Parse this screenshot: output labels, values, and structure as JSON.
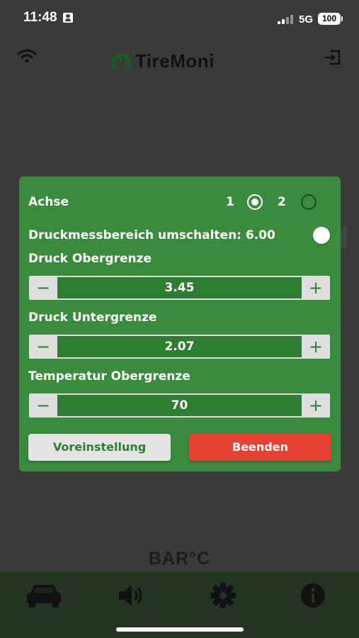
{
  "status_bar": {
    "time": "11:48",
    "network": "5G",
    "battery": "100"
  },
  "app": {
    "logo_text": "TireMoni",
    "units": "BAR°C"
  },
  "modal": {
    "axle_label": "Achse",
    "axle_options": [
      "1",
      "2"
    ],
    "axle_selected": "1",
    "range_toggle_label": "Druckmessbereich umschalten: 6.00",
    "pressure_upper": {
      "label": "Druck Obergrenze",
      "value": "3.45",
      "minus": "−",
      "plus": "+"
    },
    "pressure_lower": {
      "label": "Druck Untergrenze",
      "value": "2.07",
      "minus": "−",
      "plus": "+"
    },
    "temperature_upper": {
      "label": "Temperatur Obergrenze",
      "value": "70",
      "minus": "−",
      "plus": "+"
    },
    "preset_button": "Voreinstellung",
    "close_button": "Beenden"
  },
  "tabbar": {
    "tabs": [
      "car-icon",
      "speaker-icon",
      "gear-icon",
      "info-icon"
    ]
  },
  "colors": {
    "modal_green": "#3a8b3d",
    "close_red": "#e44232",
    "tabbar": "#243524"
  }
}
